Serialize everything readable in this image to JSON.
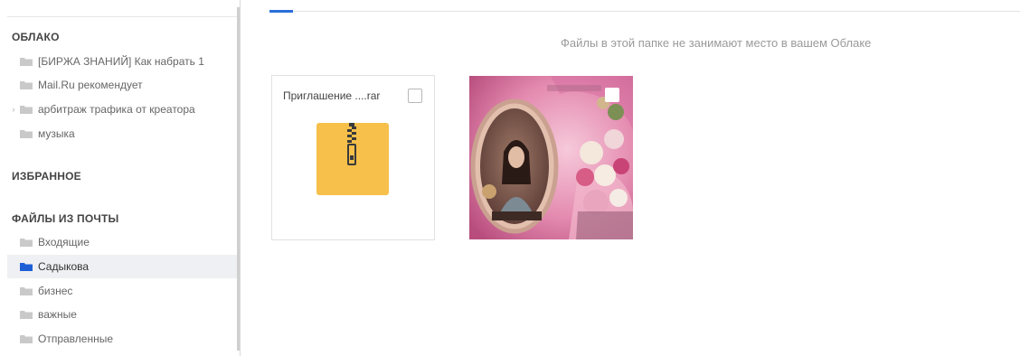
{
  "sidebar": {
    "sections": [
      {
        "title": "ОБЛАКО"
      },
      {
        "title": "ИЗБРАННОЕ"
      },
      {
        "title": "ФАЙЛЫ ИЗ ПОЧТЫ"
      }
    ],
    "cloud_items": [
      {
        "label": "[БИРЖА ЗНАНИЙ] Как набрать 1",
        "icon": "folder-icon"
      },
      {
        "label": "Mail.Ru рекомендует",
        "icon": "folder-icon"
      },
      {
        "label": "арбитраж трафика от креатора",
        "icon": "folder-icon",
        "expandable": true
      },
      {
        "label": "музыка",
        "icon": "folder-icon"
      }
    ],
    "mail_items": [
      {
        "label": "Входящие",
        "icon": "folder-icon"
      },
      {
        "label": "Садыкова",
        "icon": "folder-icon",
        "selected": true
      },
      {
        "label": "бизнес",
        "icon": "folder-icon"
      },
      {
        "label": "важные",
        "icon": "folder-icon"
      },
      {
        "label": "Отправленные",
        "icon": "folder-icon"
      }
    ]
  },
  "main": {
    "info_text": "Файлы в этой папке не занимают место в вашем Облаке",
    "files": [
      {
        "name": "Приглашение ....rar",
        "type": "archive",
        "icon": "zip-archive-icon"
      },
      {
        "name": "",
        "type": "image",
        "icon": "image-thumbnail"
      }
    ]
  },
  "colors": {
    "accent": "#2a6fdb",
    "folder_gray": "#c9c9c9",
    "folder_selected": "#1f5fd6",
    "archive": "#f7c04a"
  }
}
